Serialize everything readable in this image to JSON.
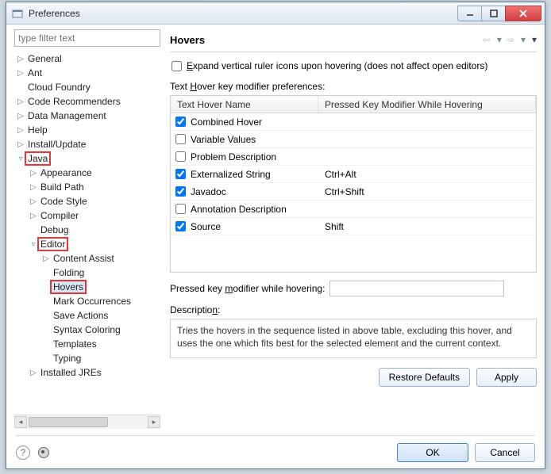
{
  "window": {
    "title": "Preferences"
  },
  "filter": {
    "placeholder": "type filter text"
  },
  "right": {
    "title": "Hovers",
    "expandCheckbox": {
      "prefix": "",
      "underlined": "E",
      "rest": "xpand vertical ruler icons upon hovering (does not affect open editors)",
      "checked": false
    },
    "tableCaption": {
      "prefix": "Text ",
      "underlined": "H",
      "rest": "over key modifier preferences:"
    },
    "table": {
      "col1": "Text Hover Name",
      "col2": "Pressed Key Modifier While Hovering",
      "rows": [
        {
          "name": "Combined Hover",
          "mod": "",
          "checked": true
        },
        {
          "name": "Variable Values",
          "mod": "",
          "checked": false
        },
        {
          "name": "Problem Description",
          "mod": "",
          "checked": false
        },
        {
          "name": "Externalized String",
          "mod": "Ctrl+Alt",
          "checked": true
        },
        {
          "name": "Javadoc",
          "mod": "Ctrl+Shift",
          "checked": true
        },
        {
          "name": "Annotation Description",
          "mod": "",
          "checked": false
        },
        {
          "name": "Source",
          "mod": "Shift",
          "checked": true
        }
      ]
    },
    "pressedField": {
      "label": "Pressed key modifier while hovering:",
      "underlined": "modifier",
      "value": ""
    },
    "descriptionLabel": {
      "prefix": "Descriptio",
      "underlined": "n",
      "rest": ":"
    },
    "description": "Tries the hovers in the sequence listed in above table, excluding this hover, and uses the one which fits best for the selected element and the current context.",
    "buttons": {
      "restore": "Restore Defaults",
      "apply": "Apply"
    }
  },
  "bottom": {
    "ok": "OK",
    "cancel": "Cancel"
  },
  "tree": [
    {
      "indent": 0,
      "tw": "▷",
      "label": "General"
    },
    {
      "indent": 0,
      "tw": "▷",
      "label": "Ant"
    },
    {
      "indent": 0,
      "tw": "",
      "label": "Cloud Foundry"
    },
    {
      "indent": 0,
      "tw": "▷",
      "label": "Code Recommenders"
    },
    {
      "indent": 0,
      "tw": "▷",
      "label": "Data Management"
    },
    {
      "indent": 0,
      "tw": "▷",
      "label": "Help"
    },
    {
      "indent": 0,
      "tw": "▷",
      "label": "Install/Update"
    },
    {
      "indent": 0,
      "tw": "▿",
      "label": "Java",
      "hl": true
    },
    {
      "indent": 1,
      "tw": "▷",
      "label": "Appearance"
    },
    {
      "indent": 1,
      "tw": "▷",
      "label": "Build Path"
    },
    {
      "indent": 1,
      "tw": "▷",
      "label": "Code Style"
    },
    {
      "indent": 1,
      "tw": "▷",
      "label": "Compiler"
    },
    {
      "indent": 1,
      "tw": "",
      "label": "Debug"
    },
    {
      "indent": 1,
      "tw": "▿",
      "label": "Editor",
      "hl": true
    },
    {
      "indent": 2,
      "tw": "▷",
      "label": "Content Assist"
    },
    {
      "indent": 2,
      "tw": "",
      "label": "Folding"
    },
    {
      "indent": 2,
      "tw": "",
      "label": "Hovers",
      "hl": true,
      "sel": true
    },
    {
      "indent": 2,
      "tw": "",
      "label": "Mark Occurrences"
    },
    {
      "indent": 2,
      "tw": "",
      "label": "Save Actions"
    },
    {
      "indent": 2,
      "tw": "",
      "label": "Syntax Coloring"
    },
    {
      "indent": 2,
      "tw": "",
      "label": "Templates"
    },
    {
      "indent": 2,
      "tw": "",
      "label": "Typing"
    },
    {
      "indent": 1,
      "tw": "▷",
      "label": "Installed JREs"
    }
  ]
}
